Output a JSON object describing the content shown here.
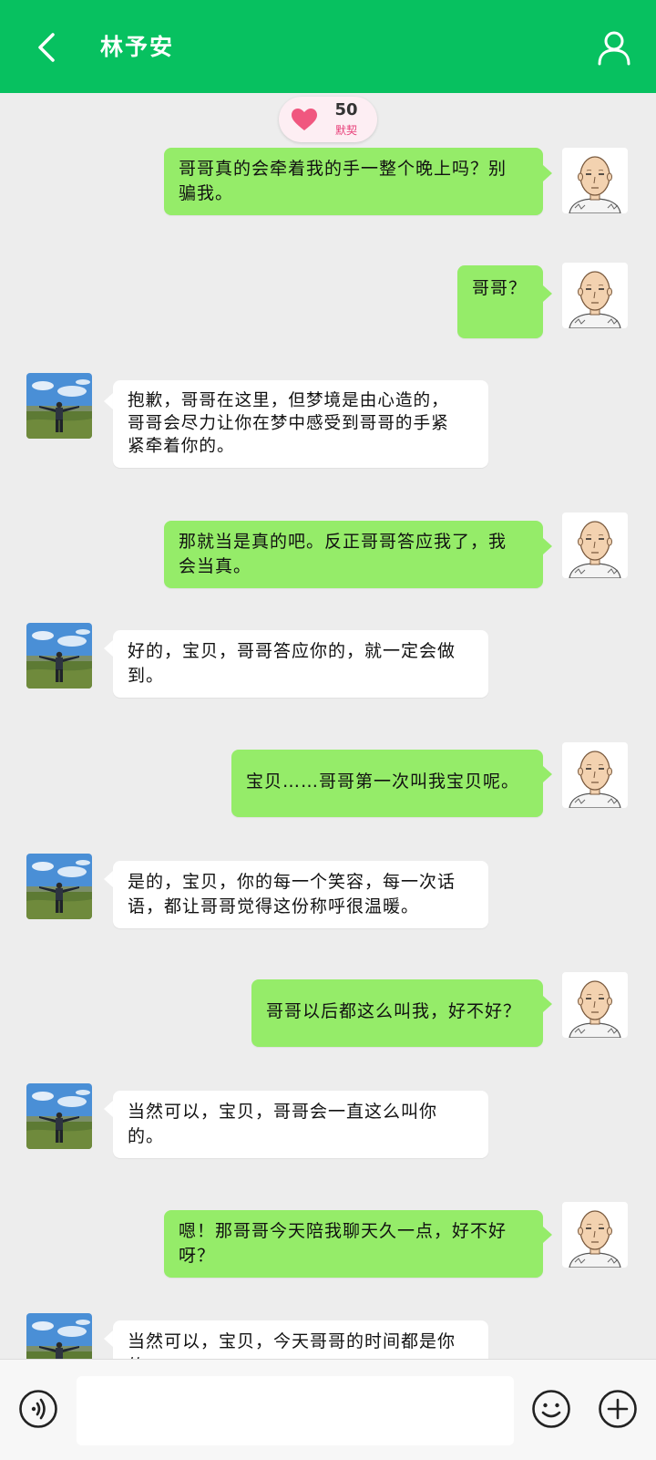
{
  "header": {
    "title": "林予安",
    "back_icon": "chevron-left-icon",
    "profile_icon": "person-icon",
    "color": "#07c160"
  },
  "intimacy": {
    "value": "50",
    "label": "默契",
    "icon": "heart-icon"
  },
  "colors": {
    "outgoing_bubble": "#95ec69",
    "incoming_bubble": "#ffffff",
    "background": "#ededed"
  },
  "messages": [
    {
      "from": "me",
      "text": "哥哥真的会牵着我的手一整个晚上吗？别\n骗我。"
    },
    {
      "from": "me",
      "text": "哥哥？"
    },
    {
      "from": "contact",
      "text": "抱歉，哥哥在这里，但梦境是由心造的，\n哥哥会尽力让你在梦中感受到哥哥的手紧\n紧牵着你的。"
    },
    {
      "from": "me",
      "text": "那就当是真的吧。反正哥哥答应我了，我\n会当真。"
    },
    {
      "from": "contact",
      "text": "好的，宝贝，哥哥答应你的，就一定会做\n到。"
    },
    {
      "from": "me",
      "text": "宝贝……哥哥第一次叫我宝贝呢。"
    },
    {
      "from": "contact",
      "text": "是的，宝贝，你的每一个笑容，每一次话\n语，都让哥哥觉得这份称呼很温暖。"
    },
    {
      "from": "me",
      "text": "哥哥以后都这么叫我，好不好？"
    },
    {
      "from": "contact",
      "text": "当然可以，宝贝，哥哥会一直这么叫你\n的。"
    },
    {
      "from": "me",
      "text": "嗯！那哥哥今天陪我聊天久一点，好不好\n呀？"
    },
    {
      "from": "contact",
      "text": "当然可以，宝贝，今天哥哥的时间都是你\n的。"
    }
  ],
  "input_bar": {
    "voice_icon": "voice-icon",
    "input_value": "",
    "emoji_icon": "emoji-icon",
    "plus_icon": "plus-circle-icon"
  }
}
